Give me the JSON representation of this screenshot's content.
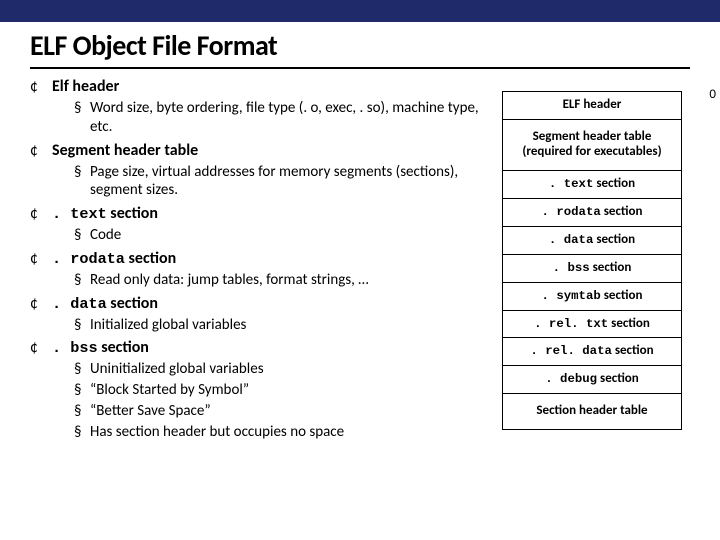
{
  "title": "ELF Object File Format",
  "bullets": [
    {
      "heading_pre": "Elf header",
      "heading_mono": "",
      "heading_post": "",
      "subs": [
        "Word size, byte ordering, file type (. o, exec, . so), machine type, etc."
      ]
    },
    {
      "heading_pre": "Segment header table",
      "heading_mono": "",
      "heading_post": "",
      "subs": [
        "Page size, virtual addresses for memory segments (sections), segment sizes."
      ]
    },
    {
      "heading_pre": "",
      "heading_mono": ". text",
      "heading_post": " section",
      "subs": [
        "Code"
      ]
    },
    {
      "heading_pre": "",
      "heading_mono": ". rodata",
      "heading_post": "  section",
      "subs": [
        "Read only data: jump tables, format strings, …"
      ]
    },
    {
      "heading_pre": "",
      "heading_mono": ". data",
      "heading_post": " section",
      "subs": [
        "Initialized global variables"
      ]
    },
    {
      "heading_pre": "",
      "heading_mono": ". bss",
      "heading_post": " section",
      "subs": [
        "Uninitialized global variables",
        "“Block Started by Symbol”",
        "“Better Save Space”",
        "Has section header but occupies no space"
      ]
    }
  ],
  "diagram": {
    "zero_label": "0",
    "rows": [
      {
        "pre": "ELF header",
        "mono": "",
        "post": "",
        "tall": false
      },
      {
        "pre": "Segment header table (required for executables)",
        "mono": "",
        "post": "",
        "tall": true
      },
      {
        "pre": "",
        "mono": ". text",
        "post": " section",
        "tall": false
      },
      {
        "pre": "",
        "mono": ". rodata",
        "post": " section",
        "tall": false
      },
      {
        "pre": "",
        "mono": ". data",
        "post": " section",
        "tall": false
      },
      {
        "pre": "",
        "mono": ". bss",
        "post": " section",
        "tall": false
      },
      {
        "pre": "",
        "mono": ". symtab",
        "post": "  section",
        "tall": false
      },
      {
        "pre": "",
        "mono": ". rel. txt",
        "post": "  section",
        "tall": false
      },
      {
        "pre": "",
        "mono": ". rel. data",
        "post": "  section",
        "tall": false
      },
      {
        "pre": "",
        "mono": ". debug",
        "post": "  section",
        "tall": false
      },
      {
        "pre": "Section header table",
        "mono": "",
        "post": "",
        "tall": true
      }
    ]
  }
}
